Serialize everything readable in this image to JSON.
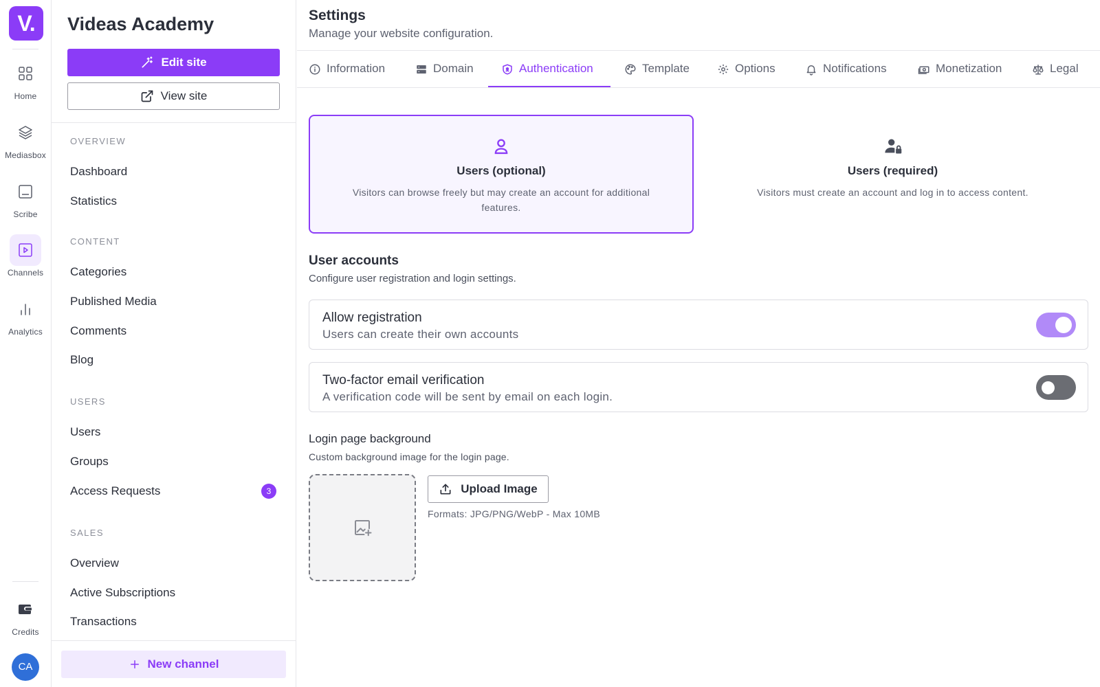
{
  "rail": {
    "logo": "V.",
    "items": [
      {
        "label": "Home",
        "icon": "grid-icon"
      },
      {
        "label": "Mediasbox",
        "icon": "layers-icon"
      },
      {
        "label": "Scribe",
        "icon": "caption-icon"
      },
      {
        "label": "Channels",
        "icon": "play-square-icon"
      },
      {
        "label": "Analytics",
        "icon": "bar-chart-icon"
      }
    ],
    "credits": "Credits",
    "avatar": "CA",
    "active": "Channels"
  },
  "sidebar": {
    "title": "Videas Academy",
    "edit_site": "Edit site",
    "view_site": "View site",
    "sections": [
      {
        "label": "OVERVIEW",
        "items": [
          "Dashboard",
          "Statistics"
        ]
      },
      {
        "label": "CONTENT",
        "items": [
          "Categories",
          "Published Media",
          "Comments",
          "Blog"
        ]
      },
      {
        "label": "USERS",
        "items": [
          "Users",
          "Groups",
          "Access Requests"
        ]
      },
      {
        "label": "SALES",
        "items": [
          "Overview",
          "Active Subscriptions",
          "Transactions"
        ]
      }
    ],
    "access_requests_badge": "3",
    "new_channel": "New channel"
  },
  "header": {
    "title": "Settings",
    "subtitle": "Manage your website configuration."
  },
  "tabs": [
    {
      "label": "Information",
      "icon": "info-icon"
    },
    {
      "label": "Domain",
      "icon": "server-icon"
    },
    {
      "label": "Authentication",
      "icon": "shield-icon",
      "active": true
    },
    {
      "label": "Template",
      "icon": "palette-icon"
    },
    {
      "label": "Options",
      "icon": "gear-icon"
    },
    {
      "label": "Notifications",
      "icon": "bell-icon"
    },
    {
      "label": "Monetization",
      "icon": "banknote-icon"
    },
    {
      "label": "Legal",
      "icon": "scale-icon"
    }
  ],
  "auth_modes": [
    {
      "title": "Users (optional)",
      "desc": "Visitors can browse freely but may create an account for additional features.",
      "icon": "user-icon",
      "selected": true
    },
    {
      "title": "Users (required)",
      "desc": "Visitors must create an account and log in to access content.",
      "icon": "user-lock-icon",
      "selected": false
    }
  ],
  "user_accounts": {
    "title": "User accounts",
    "subtitle": "Configure user registration and login settings.",
    "settings": [
      {
        "name": "Allow registration",
        "hint": "Users can create their own accounts",
        "enabled": true
      },
      {
        "name": "Two-factor email verification",
        "hint": "A verification code will be sent by email on each login.",
        "enabled": false
      }
    ]
  },
  "login_background": {
    "title": "Login page background",
    "subtitle": "Custom background image for the login page.",
    "upload_label": "Upload Image",
    "formats": "Formats: JPG/PNG/WebP - Max 10MB"
  },
  "colors": {
    "accent": "#8b3cf7",
    "accent_light": "#f1eafe",
    "toggle_on": "#b18af8",
    "toggle_off": "#6b6d73",
    "avatar": "#2f6fd8"
  }
}
